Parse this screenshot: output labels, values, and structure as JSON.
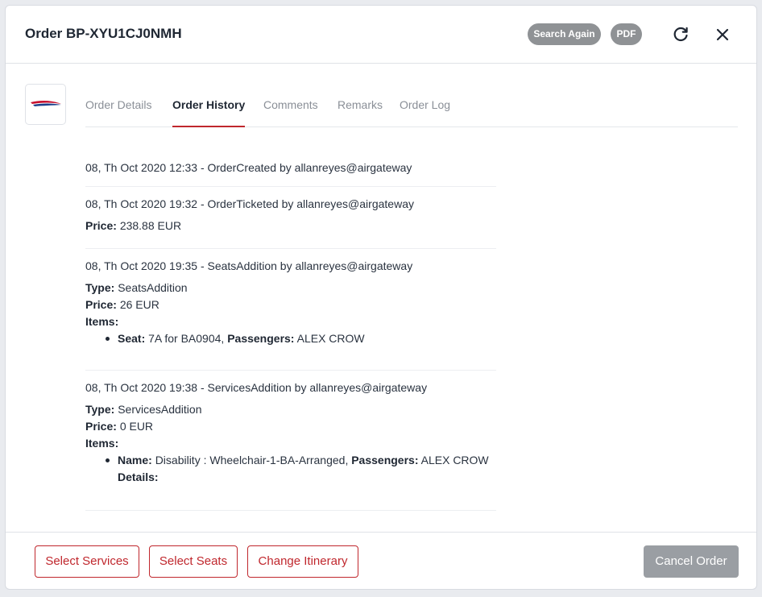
{
  "header": {
    "order_title": "Order BP-XYU1CJ0NMH",
    "search_again_label": "Search Again",
    "pdf_label": "PDF",
    "refresh_icon": "refresh-icon",
    "close_icon": "close-icon"
  },
  "airline_logo": "british-airways-logo",
  "tabs": [
    {
      "label": "Order Details",
      "active": false
    },
    {
      "label": "Order History",
      "active": true
    },
    {
      "label": "Comments",
      "active": false
    },
    {
      "label": "Remarks",
      "active": false
    },
    {
      "label": "Order Log",
      "active": false
    }
  ],
  "history": [
    {
      "headline": "08, Th Oct 2020 12:33 - OrderCreated by allanreyes@airgateway"
    },
    {
      "headline": "08, Th Oct 2020 19:32 - OrderTicketed by allanreyes@airgateway",
      "price_label": "Price:",
      "price_value": "238.88 EUR"
    },
    {
      "headline": "08, Th Oct 2020 19:35 - SeatsAddition by allanreyes@airgateway",
      "type_label": "Type:",
      "type_value": "SeatsAddition",
      "price_label": "Price:",
      "price_value": "26 EUR",
      "items_label": "Items:",
      "items": [
        {
          "label1": "Seat:",
          "value1": "7A for BA0904,",
          "label2": "Passengers:",
          "value2": "ALEX CROW"
        }
      ]
    },
    {
      "headline": "08, Th Oct 2020 19:38 - ServicesAddition by allanreyes@airgateway",
      "type_label": "Type:",
      "type_value": "ServicesAddition",
      "price_label": "Price:",
      "price_value": "0 EUR",
      "items_label": "Items:",
      "items": [
        {
          "label1": "Name:",
          "value1": "Disability : Wheelchair-1-BA-Arranged,",
          "label2": "Passengers:",
          "value2": "ALEX CROW",
          "label3": "Details:"
        }
      ]
    }
  ],
  "footer": {
    "select_services": "Select Services",
    "select_seats": "Select Seats",
    "change_itinerary": "Change Itinerary",
    "cancel_order": "Cancel Order"
  },
  "colors": {
    "accent": "#c0272d",
    "pill_bg": "#8f9295",
    "disabled_bg": "#9a9ea3"
  }
}
